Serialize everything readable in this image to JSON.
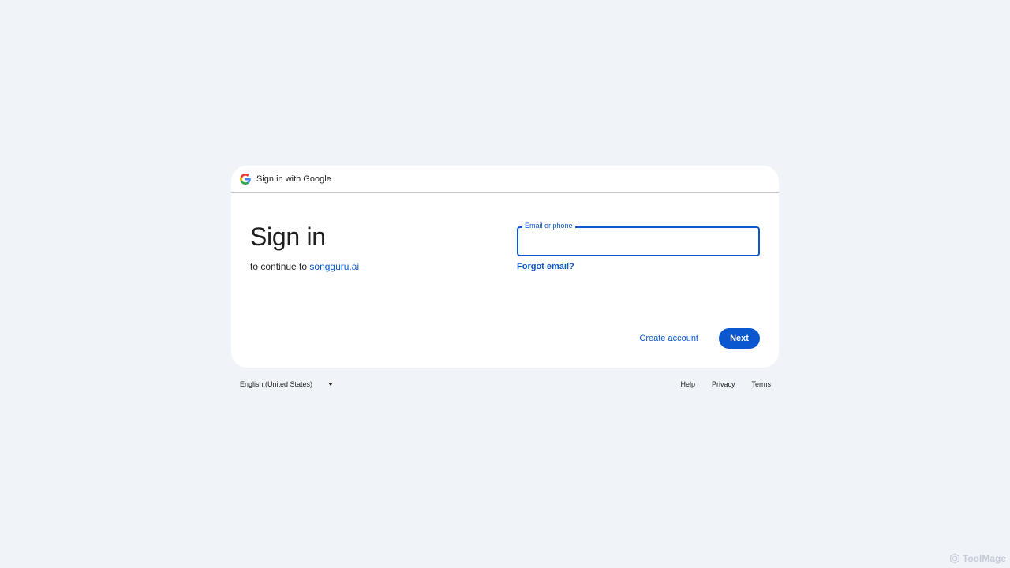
{
  "header": {
    "title": "Sign in with Google"
  },
  "main": {
    "title": "Sign in",
    "subtitle_prefix": "to continue to ",
    "app_name": "songguru.ai",
    "email_label": "Email or phone",
    "email_value": "",
    "forgot_email": "Forgot email?",
    "create_account": "Create account",
    "next": "Next"
  },
  "footer": {
    "language": "English (United States)",
    "links": [
      "Help",
      "Privacy",
      "Terms"
    ]
  },
  "watermark": {
    "text": "ToolMage"
  },
  "colors": {
    "background": "#f0f4f9",
    "accent": "#0b57d0",
    "card": "#ffffff"
  },
  "icons": {
    "header_logo": "google-g-icon",
    "language_caret": "caret-down-icon",
    "watermark_logo": "hexagon-logo-icon"
  }
}
